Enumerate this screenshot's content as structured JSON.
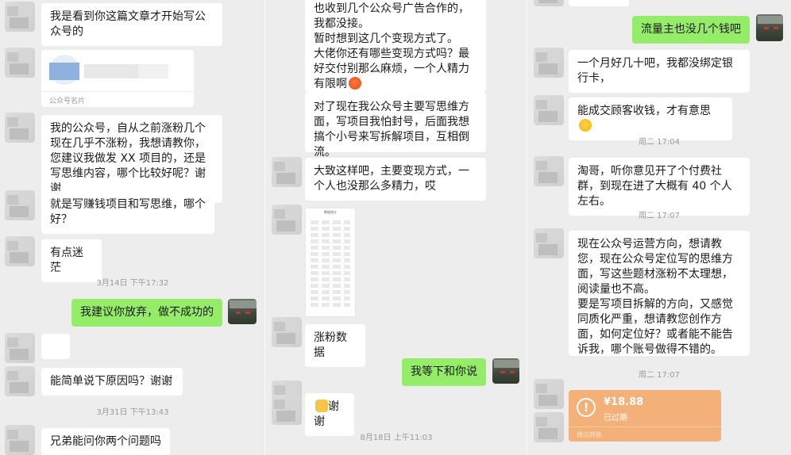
{
  "col1": {
    "m1": "我是看到你这篇文章才开始写公众号的",
    "card_label": "公众号名片",
    "m2": "我的公众号，自从之前涨粉几个现在几乎不涨粉，我想请教你，您建议我做发 XX 项目的，还是写思维内容，哪个比较好呢？谢谢",
    "m3": "就是写赚钱项目和写思维，哪个好？",
    "m4": "有点迷茫",
    "t1": "3月14日 下午17:32",
    "m5": "我建议你放弃，做不成功的",
    "m6_icon": "angry-emoji",
    "m7": "能简单说下原因吗？谢谢",
    "t2": "3月31日 下午13:43",
    "m8": "兄弟能问你两个问题吗"
  },
  "col2": {
    "m1": "也收到几个公众号广告合作的，我都没接。\n暂时想到这几个变现方式了。\n大佬你还有哪些变现方式吗？最好交付别那么麻烦，一个人精力有限啊",
    "m1b": "对了现在我公众号主要写思维方面，写项目我怕封号，后面我想搞个小号来写拆解项目，互相倒流。",
    "m2": "大致这样吧，主要变现方式，一个人也没那么多精力，哎",
    "shot_title": "数据统计",
    "m3": "涨粉数据",
    "m4": "我等下和你说",
    "m5": "谢谢",
    "m5_icon": "clap-emoji",
    "t1": "8月18日 上午11:03"
  },
  "col3": {
    "m1": "流量主也没几个钱吧",
    "m2": "一个月好几十吧，我都没绑定银行卡，",
    "m3": "能成交顾客收钱，才有意思",
    "m3_icon": "thinking-emoji",
    "t1": "周二 17:04",
    "m4": "淘哥，听你意见开了个付费社群，到现在进了大概有 40 个人左右。",
    "t2": "周二 17:07",
    "m5": "现在公众号运营方向，想请教您，现在公众号定位写的思维方面，写这些题材涨粉不太理想，阅读量也不高。\n要是写项目拆解的方向，又感觉同质化严重，想请教您创作方面，如何定位好？或者能不能告诉我，哪个账号做得不错的。",
    "t3": "周二 17:07",
    "red_amount": "¥18.88",
    "red_status": "已过期",
    "red_footer": "微信转账"
  },
  "colors": {
    "bg": "#ededed",
    "green": "#95ec69",
    "bubble": "#ffffff",
    "transfer": "#f3b179"
  }
}
